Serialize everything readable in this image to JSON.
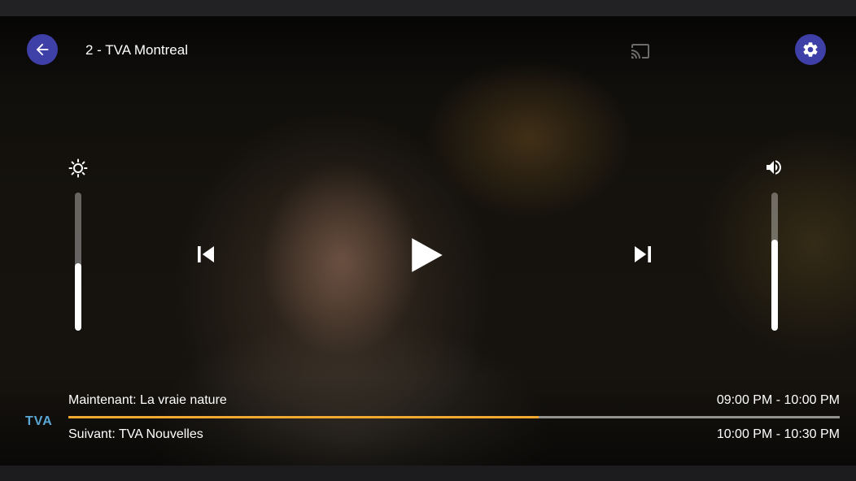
{
  "channel": {
    "title": "2 - TVA Montreal",
    "logo_text": "TVA"
  },
  "icons": {
    "back": "arrow-left-icon",
    "settings": "gear-icon",
    "cast": "cast-icon",
    "brightness": "brightness-icon",
    "volume": "volume-icon",
    "previous": "skip-previous-icon",
    "play": "play-icon",
    "next": "skip-next-icon"
  },
  "controls": {
    "brightness_level": 0.49,
    "volume_level": 0.66
  },
  "epg": {
    "now_label": "Maintenant: La vraie nature",
    "now_time": "09:00 PM - 10:00 PM",
    "next_label": "Suivant: TVA Nouvelles",
    "next_time": "10:00 PM - 10:30 PM",
    "progress": 0.61
  },
  "colors": {
    "accent": "#3f3fa8",
    "progress": "#f0a830",
    "logo": "#5aa8d6"
  }
}
